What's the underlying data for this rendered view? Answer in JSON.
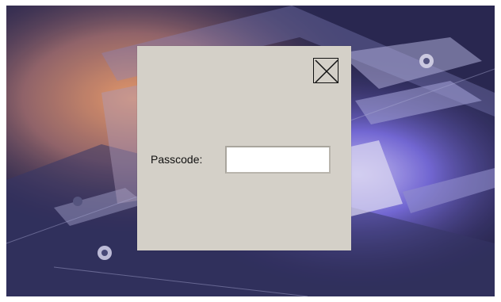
{
  "dialog": {
    "close_icon": "close-x-icon",
    "passcode_label": "Passcode:",
    "passcode_value": ""
  },
  "colors": {
    "dialog_background": "#d4d0c8",
    "backdrop_base": "#2a2850",
    "backdrop_glow_warm": "#f0a070",
    "backdrop_glow_violet": "#cfc6ff"
  }
}
